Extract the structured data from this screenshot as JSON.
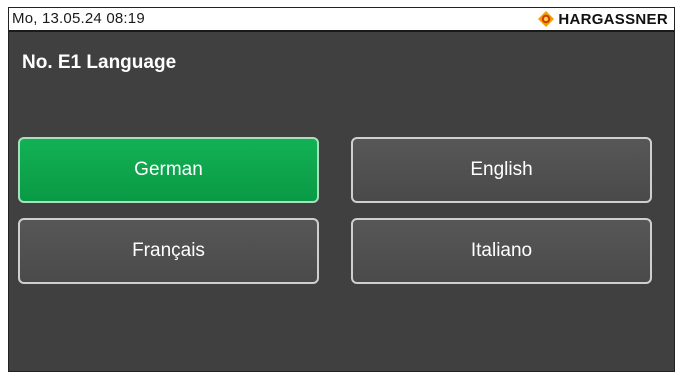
{
  "statusbar": {
    "datetime": "Mo, 13.05.24 08:19",
    "brand": "HARGASSNER",
    "brand_icon": "hargassner-logo-icon"
  },
  "page": {
    "title": "No. E1 Language"
  },
  "languages": [
    {
      "label": "German",
      "selected": true
    },
    {
      "label": "English",
      "selected": false
    },
    {
      "label": "Français",
      "selected": false
    },
    {
      "label": "Italiano",
      "selected": false
    }
  ],
  "colors": {
    "background": "#404040",
    "selected": "#0fa64d",
    "button": "#505050"
  }
}
